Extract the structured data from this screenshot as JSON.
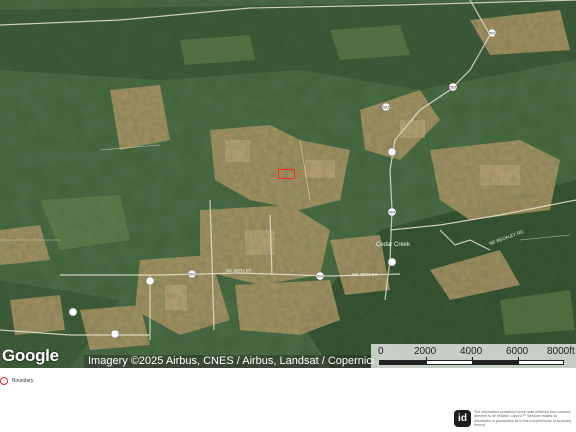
{
  "map": {
    "attribution": "Imagery ©2025 Airbus, CNES / Airbus, Landsat / Copernicus",
    "logo_text": "Google",
    "scale": {
      "unit": "ft",
      "labels": [
        "0",
        "2000",
        "4000",
        "6000",
        "8000ft"
      ]
    },
    "road_labels": {
      "ne_49th_st_west": "NE 49TH ST",
      "ne_49th_st_east": "NE 49TH ST",
      "ne_beckley_rd": "NE BECKLEY RD",
      "route_503_a": "503",
      "route_503_b": "503",
      "route_503_c": "503",
      "route_503_d": "503",
      "route_503_e": "503",
      "route_503_f": "503",
      "town": "Cedar Creek"
    },
    "boundary_color": "#ff2a1a"
  },
  "legend": {
    "items": [
      {
        "label": "Boundary",
        "color": "#e0261a"
      }
    ]
  },
  "footer": {
    "logo_text": "id",
    "disclaimer": "The information contained herein was obtained from sources deemed to be reliable. Land id™ Services makes no warranties or guarantees as to the completeness or accuracy thereof."
  }
}
